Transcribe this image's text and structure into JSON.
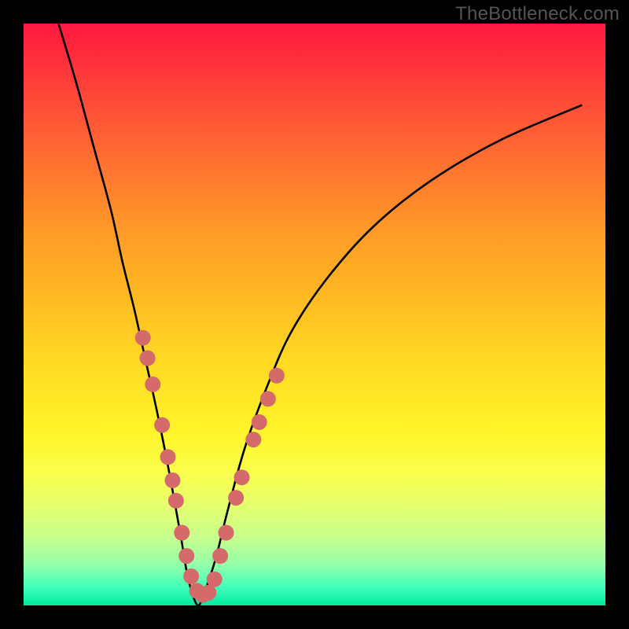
{
  "watermark": "TheBottleneck.com",
  "chart_data": {
    "type": "line",
    "title": "",
    "xlabel": "",
    "ylabel": "",
    "xlim": [
      0,
      100
    ],
    "ylim": [
      0,
      100
    ],
    "grid": false,
    "legend": false,
    "series": [
      {
        "name": "bottleneck-curve",
        "color": "#000000",
        "x": [
          6,
          9,
          12,
          15,
          17,
          19,
          21,
          23,
          25,
          27,
          28,
          29,
          30,
          31,
          33,
          35,
          38,
          42,
          46,
          52,
          60,
          70,
          82,
          96
        ],
        "y": [
          100,
          90,
          79,
          68,
          59,
          51,
          42,
          33,
          23,
          12,
          6,
          2,
          0,
          2,
          8,
          16,
          27,
          38,
          47,
          56,
          65,
          73,
          80,
          86
        ]
      }
    ],
    "markers": [
      {
        "name": "left-branch-dots",
        "color": "#d46a6a",
        "radius": 10,
        "points": [
          [
            20.5,
            46
          ],
          [
            21.3,
            42.5
          ],
          [
            22.2,
            38
          ],
          [
            23.8,
            31
          ],
          [
            24.8,
            25.5
          ],
          [
            25.6,
            21.5
          ],
          [
            26.2,
            18
          ],
          [
            27.2,
            12.5
          ],
          [
            28.0,
            8.5
          ],
          [
            28.8,
            5
          ],
          [
            29.8,
            2.5
          ],
          [
            30.8,
            1.8
          ],
          [
            31.8,
            2.2
          ],
          [
            32.8,
            4.5
          ]
        ]
      },
      {
        "name": "right-branch-dots",
        "color": "#d46a6a",
        "radius": 10,
        "points": [
          [
            33.8,
            8.5
          ],
          [
            34.8,
            12.5
          ],
          [
            36.5,
            18.5
          ],
          [
            37.5,
            22
          ],
          [
            39.5,
            28.5
          ],
          [
            40.5,
            31.5
          ],
          [
            42.0,
            35.5
          ],
          [
            43.5,
            39.5
          ]
        ]
      }
    ]
  }
}
